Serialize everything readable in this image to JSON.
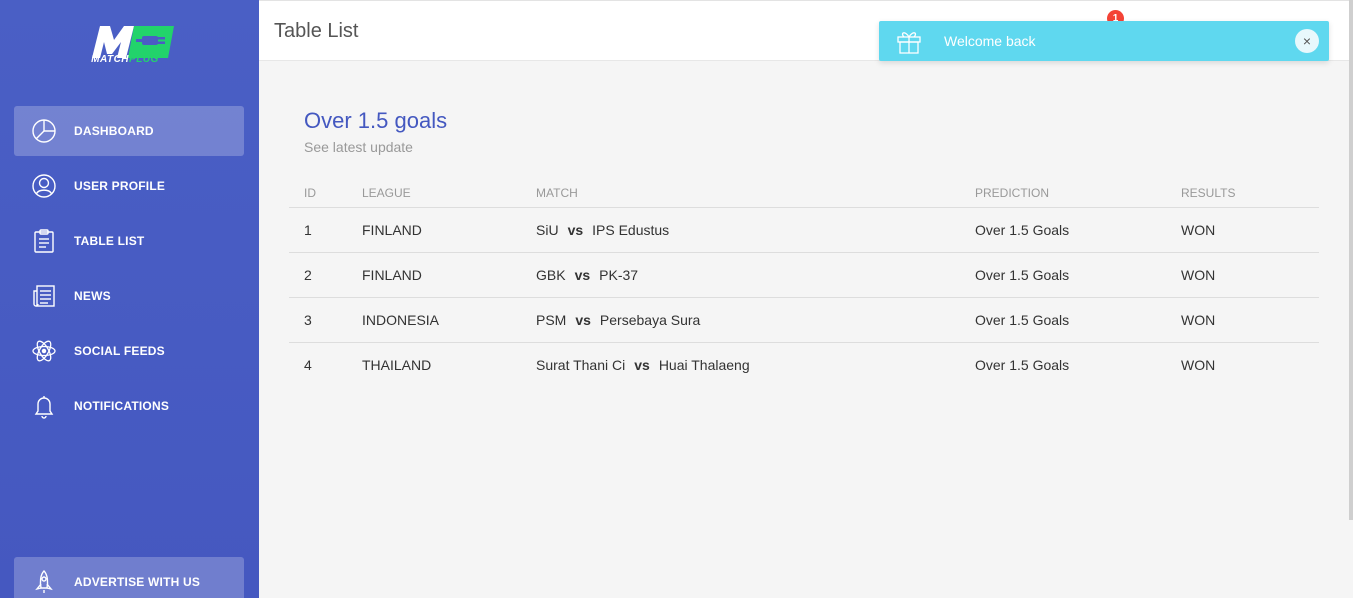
{
  "brand": {
    "logo_mark": "MP",
    "name_part1": "MATCH",
    "name_part2": "PLUG",
    "colors": {
      "sidebar": "#4b5cc4",
      "accent_green": "#22d36b",
      "title_blue": "#4458c0",
      "toast": "#5fd8ef",
      "badge": "#f44336"
    }
  },
  "sidebar": {
    "items": [
      {
        "label": "DASHBOARD",
        "icon": "pie-chart-icon",
        "active": true
      },
      {
        "label": "USER PROFILE",
        "icon": "user-icon",
        "active": false
      },
      {
        "label": "TABLE LIST",
        "icon": "clipboard-icon",
        "active": false
      },
      {
        "label": "NEWS",
        "icon": "newspaper-icon",
        "active": false
      },
      {
        "label": "SOCIAL FEEDS",
        "icon": "atom-icon",
        "active": false
      },
      {
        "label": "NOTIFICATIONS",
        "icon": "bell-icon",
        "active": false
      }
    ],
    "advertise": {
      "label": "ADVERTISE WITH US",
      "icon": "rocket-icon"
    }
  },
  "header": {
    "title": "Table List",
    "notification_count": "1"
  },
  "toast": {
    "message": "Welcome back",
    "icon": "gift-icon",
    "close_glyph": "×"
  },
  "card": {
    "title": "Over 1.5 goals",
    "subtitle": "See latest update"
  },
  "table": {
    "columns": [
      "ID",
      "LEAGUE",
      "MATCH",
      "PREDICTION",
      "RESULTS"
    ],
    "vs_label": "vs",
    "rows": [
      {
        "id": "1",
        "league": "FINLAND",
        "home": "SiU",
        "away": "IPS Edustus",
        "prediction": "Over 1.5 Goals",
        "result": "WON"
      },
      {
        "id": "2",
        "league": "FINLAND",
        "home": "GBK",
        "away": "PK-37",
        "prediction": "Over 1.5 Goals",
        "result": "WON"
      },
      {
        "id": "3",
        "league": "INDONESIA",
        "home": "PSM",
        "away": "Persebaya Sura",
        "prediction": "Over 1.5 Goals",
        "result": "WON"
      },
      {
        "id": "4",
        "league": "THAILAND",
        "home": "Surat Thani Ci",
        "away": "Huai Thalaeng",
        "prediction": "Over 1.5 Goals",
        "result": "WON"
      }
    ]
  }
}
